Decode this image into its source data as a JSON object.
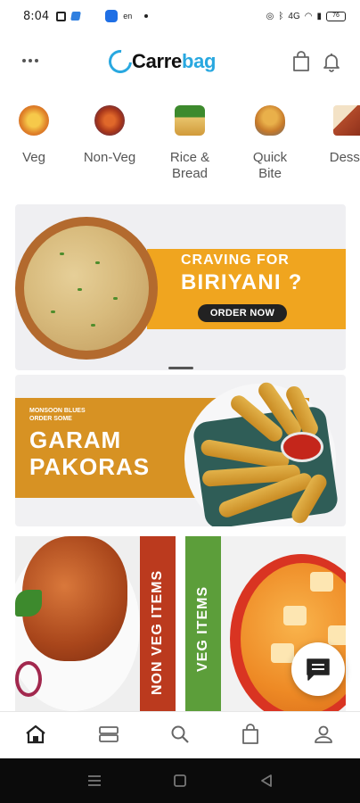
{
  "status_bar": {
    "time": "8:04",
    "carrier_small": "en",
    "network_text": "4G",
    "battery_text": "76"
  },
  "header": {
    "logo_part1": "Carre",
    "logo_part2": "bag",
    "icons": [
      "more-icon",
      "shopping-bag-icon",
      "bell-icon"
    ]
  },
  "categories": [
    {
      "label": "Veg",
      "icon": "veg-thali-icon"
    },
    {
      "label": "Non-Veg",
      "icon": "non-veg-plate-icon"
    },
    {
      "label": "Rice &\nBread",
      "icon": "rice-bread-icon"
    },
    {
      "label": "Quick\nBite",
      "icon": "quick-bite-icon"
    },
    {
      "label": "Desse",
      "icon": "dessert-icon"
    }
  ],
  "banners": {
    "biriyani": {
      "line1": "CRAVING FOR",
      "line2": "BIRIYANI ?",
      "cta": "ORDER NOW"
    },
    "pakoras": {
      "small_line1": "MONSOON BLUES",
      "small_line2": "ORDER SOME",
      "big_line1": "GARAM",
      "big_line2": "PAKORAS"
    }
  },
  "tiles": {
    "non_veg": "NON VEG ITEMS",
    "veg": "VEG ITEMS"
  },
  "bottom_nav": [
    {
      "name": "home",
      "icon": "home-icon",
      "active": true
    },
    {
      "name": "categories",
      "icon": "layers-icon",
      "active": false
    },
    {
      "name": "search",
      "icon": "search-icon",
      "active": false
    },
    {
      "name": "cart",
      "icon": "shopping-bag-icon",
      "active": false
    },
    {
      "name": "profile",
      "icon": "user-icon",
      "active": false
    }
  ],
  "colors": {
    "brand_blue": "#29a8e0",
    "banner_yellow": "#f0a51f",
    "nonveg_red": "#bb3a1e",
    "veg_green": "#5c9e3a"
  }
}
